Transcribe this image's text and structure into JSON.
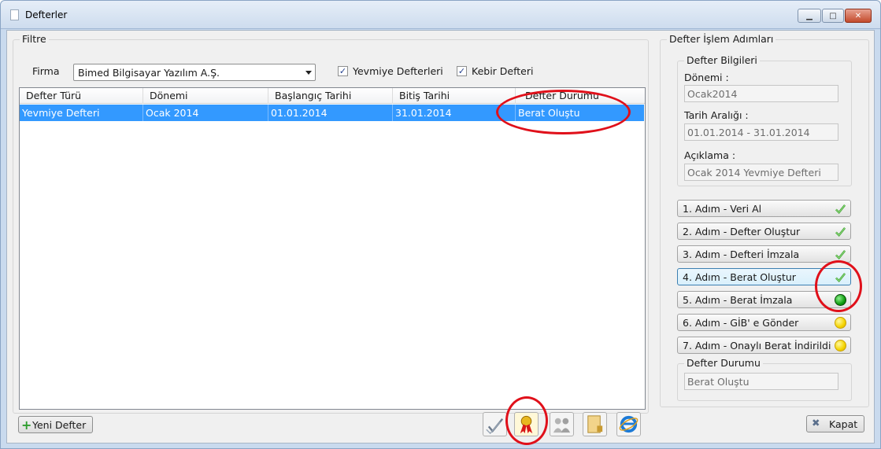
{
  "window": {
    "title": "Defterler"
  },
  "filter": {
    "group_label": "Filtre",
    "firma_label": "Firma",
    "firma_value": "Bimed Bilgisayar Yazılım A.Ş.",
    "yevmiye_label": "Yevmiye Defterleri",
    "yevmiye_checked": true,
    "kebir_label": "Kebir Defteri",
    "kebir_checked": true
  },
  "grid": {
    "columns": [
      "Defter Türü",
      "Dönemi",
      "Başlangıç Tarihi",
      "Bitiş Tarihi",
      "Defter Durumu"
    ],
    "rows": [
      [
        "Yevmiye Defteri",
        "Ocak 2014",
        "01.01.2014",
        "31.01.2014",
        "Berat Oluştu"
      ]
    ]
  },
  "side": {
    "group_label": "Defter İşlem Adımları",
    "info_label": "Defter Bilgileri",
    "donem_label": "Dönemi :",
    "donem_value": "Ocak2014",
    "tarih_label": "Tarih Aralığı :",
    "tarih_value": "01.01.2014 - 31.01.2014",
    "aciklama_label": "Açıklama :",
    "aciklama_value": "Ocak 2014 Yevmiye Defteri",
    "steps": [
      {
        "label": "1. Adım - Veri Al",
        "status": "check-icon"
      },
      {
        "label": "2. Adım - Defter Oluştur",
        "status": "check-icon"
      },
      {
        "label": "3. Adım - Defteri İmzala",
        "status": "check-icon"
      },
      {
        "label": "4. Adım - Berat Oluştur",
        "status": "check-icon"
      },
      {
        "label": "5. Adım - Berat İmzala",
        "status": "green-dot-icon"
      },
      {
        "label": "6. Adım - GİB' e Gönder",
        "status": "yellow-dot-icon"
      },
      {
        "label": "7. Adım - Onaylı Berat İndirildi",
        "status": "yellow-dot-icon"
      }
    ],
    "durum_label": "Defter Durumu",
    "durum_value": "Berat Oluştu"
  },
  "footer": {
    "new_button": "Yeni Defter",
    "close_button": "Kapat",
    "toolbar_icons": [
      "checklist-icon",
      "ribbon-award-icon",
      "people-icon",
      "folder-lock-icon",
      "internet-explorer-icon"
    ]
  },
  "colors": {
    "selection": "#3399ff",
    "annotation": "#e0101a"
  }
}
